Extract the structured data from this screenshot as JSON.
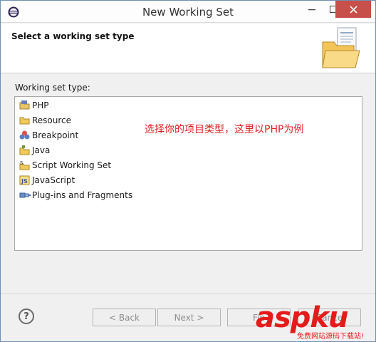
{
  "window": {
    "title": "New Working Set"
  },
  "banner": {
    "heading": "Select a working set type"
  },
  "list": {
    "label": "Working set type:",
    "items": [
      {
        "label": "PHP",
        "icon": "php-project-icon"
      },
      {
        "label": "Resource",
        "icon": "folder-icon"
      },
      {
        "label": "Breakpoint",
        "icon": "breakpoint-icon"
      },
      {
        "label": "Java",
        "icon": "java-package-icon"
      },
      {
        "label": "Script Working Set",
        "icon": "script-icon"
      },
      {
        "label": "JavaScript",
        "icon": "javascript-icon"
      },
      {
        "label": "Plug-ins and Fragments",
        "icon": "plugin-icon"
      }
    ]
  },
  "annotation": "选择你的项目类型，这里以PHP为例",
  "footer": {
    "help": "?",
    "back_label": "< Back",
    "next_label": "Next >",
    "finish_label": "Fin",
    "cancel_label": "Cance"
  },
  "watermark": {
    "logo": "aspku",
    "tagline": "免费网站源码下载站!"
  },
  "colors": {
    "accent": "#e41b1b",
    "annotation": "#e02020",
    "close_button": "#c7504a"
  }
}
